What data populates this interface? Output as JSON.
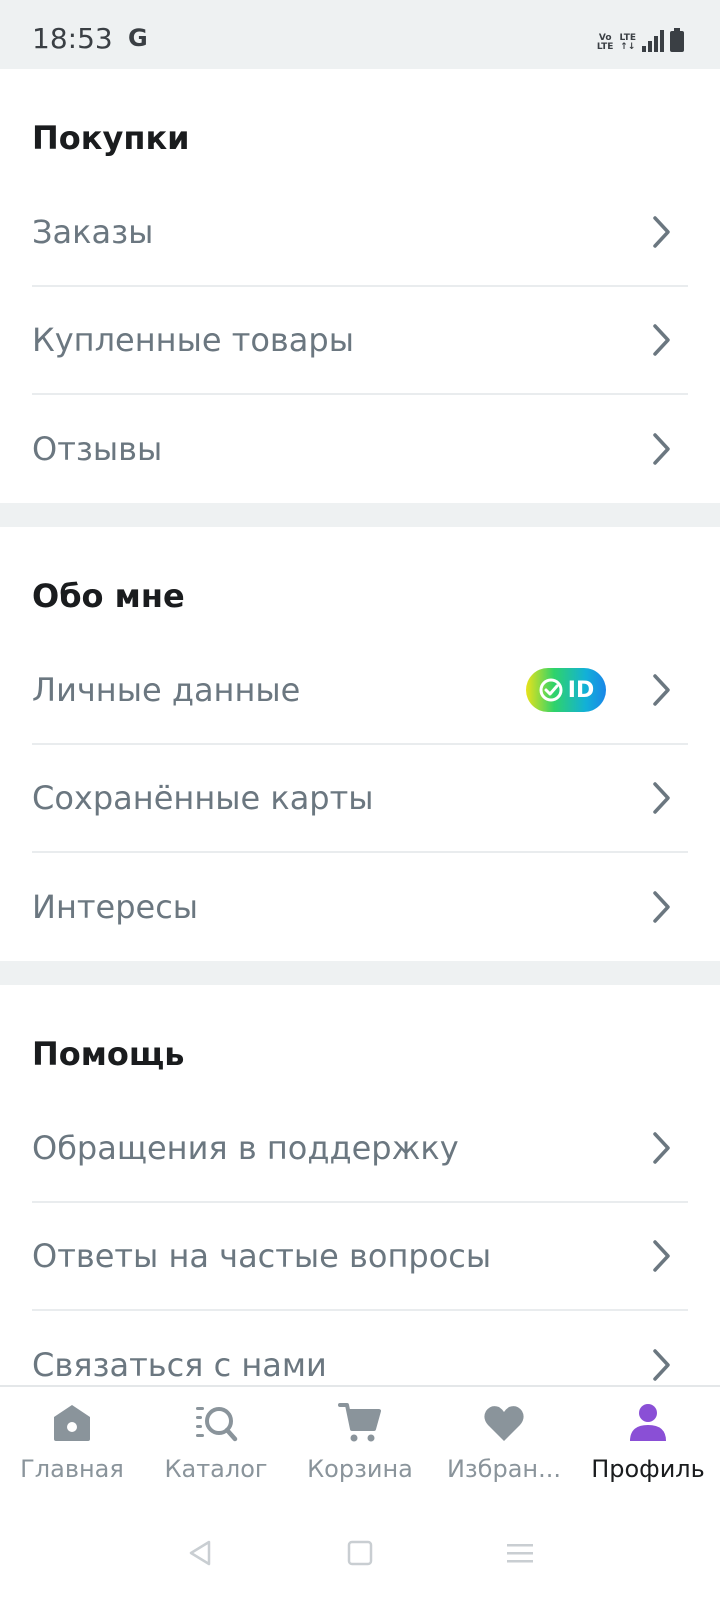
{
  "status_bar": {
    "time": "18:53",
    "carrier_icon": "G"
  },
  "sections": [
    {
      "title": "Покупки",
      "items": [
        "Заказы",
        "Купленные товары",
        "Отзывы"
      ]
    },
    {
      "title": "Обо мне",
      "items": [
        "Личные данные",
        "Сохранённые карты",
        "Интересы"
      ],
      "badge": "ID"
    },
    {
      "title": "Помощь",
      "items": [
        "Обращения в поддержку",
        "Ответы на частые вопросы",
        "Связаться с нами"
      ]
    }
  ],
  "bottom_nav": [
    {
      "label": "Главная",
      "icon": "home-icon"
    },
    {
      "label": "Каталог",
      "icon": "catalog-icon"
    },
    {
      "label": "Корзина",
      "icon": "cart-icon"
    },
    {
      "label": "Избран...",
      "icon": "heart-icon"
    },
    {
      "label": "Профиль",
      "icon": "profile-icon",
      "active": true
    }
  ],
  "colors": {
    "accent": "#8a4fd6",
    "inactive": "#8a949b"
  }
}
